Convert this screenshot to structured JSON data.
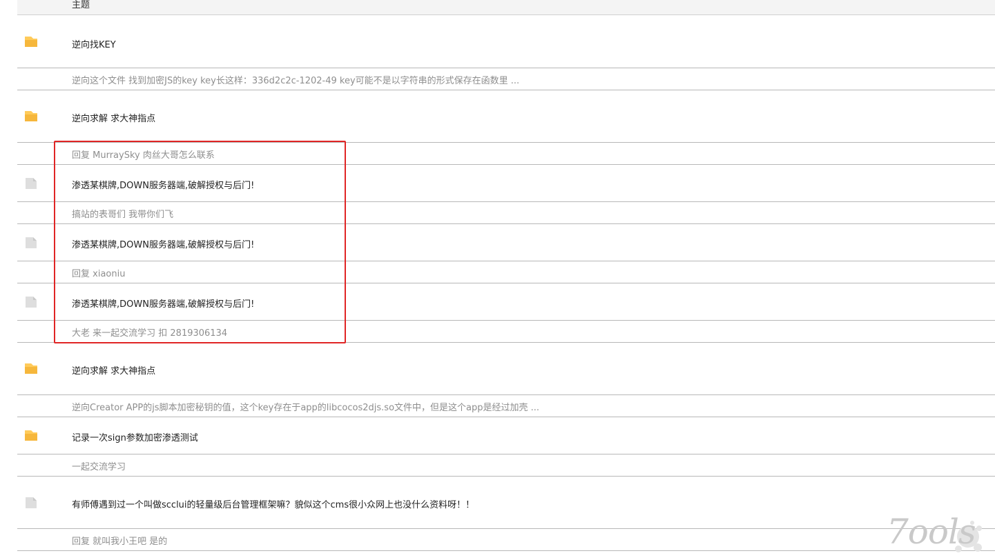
{
  "table_header": {
    "subject_label": "主题"
  },
  "colors": {
    "folder_icon": "#f6b73c",
    "page_icon": "#dedede",
    "highlight_border": "#e02424"
  },
  "topics": [
    {
      "icon": "folder-icon",
      "title": "逆向找KEY",
      "summary": "逆向这个文件 找到加密JS的key key长这样：336d2c2c-1202-49 key可能不是以字符串的形式保存在函数里 ..."
    },
    {
      "icon": "folder-icon",
      "title": "逆向求解 求大神指点",
      "summary": "回复 MurraySky 肉丝大哥怎么联系"
    },
    {
      "icon": "page-icon",
      "title": "渗透某棋牌,DOWN服务器端,破解授权与后门!",
      "summary": "搞站的表哥们 我带你们飞"
    },
    {
      "icon": "page-icon",
      "title": "渗透某棋牌,DOWN服务器端,破解授权与后门!",
      "summary": "回复 xiaoniu"
    },
    {
      "icon": "page-icon",
      "title": "渗透某棋牌,DOWN服务器端,破解授权与后门!",
      "summary": "大老 来一起交流学习 扣 2819306134"
    },
    {
      "icon": "folder-icon",
      "title": "逆向求解 求大神指点",
      "summary": "逆向Creator APP的js脚本加密秘钥的值，这个key存在于app的libcocos2djs.so文件中，但是这个app是经过加壳 ..."
    },
    {
      "icon": "folder-icon",
      "title": "记录一次sign参数加密渗透测试",
      "summary": "一起交流学习"
    },
    {
      "icon": "page-icon",
      "title": "有师傅遇到过一个叫做scclui的轻量级后台管理框架嘛？貌似这个cms很小众网上也没什么资料呀！！",
      "summary": "回复 就叫我小王吧 是的"
    }
  ],
  "watermark": {
    "text": "7ools"
  }
}
